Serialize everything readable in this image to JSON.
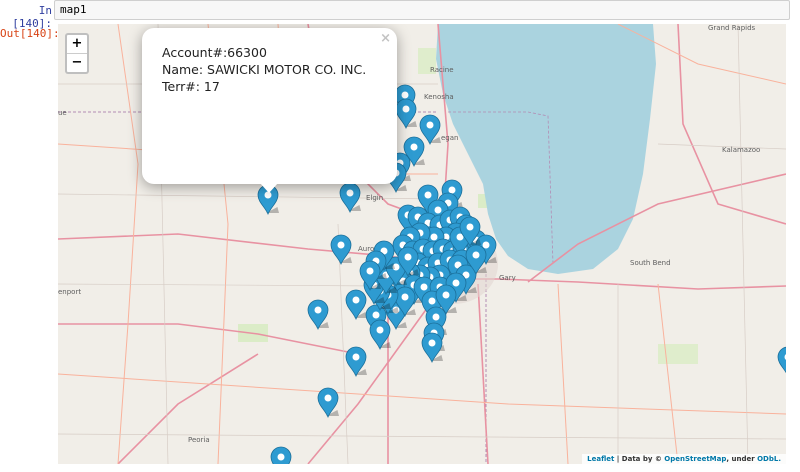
{
  "notebook": {
    "in_prompt": "In [140]:",
    "out_prompt": "Out[140]:",
    "input_code": "map1"
  },
  "map": {
    "zoom_in": "+",
    "zoom_out": "−",
    "popup": {
      "close": "×",
      "lines": [
        "Account#:66300",
        "Name: SAWICKI MOTOR CO. INC.",
        "Terr#: 17"
      ]
    },
    "places": {
      "racine": "Racine",
      "kenosha": "Kenosha",
      "waukegan": "egan",
      "elgin": "Elgin",
      "aurora": "Auro",
      "gary": "Gary",
      "south_bend": "South Bend",
      "kalamazoo": "Kalamazoo",
      "grand_rapids": "Grand Rapids",
      "davenport": "enport",
      "peoria": "Peoria",
      "left_edge": "ue"
    },
    "attribution": {
      "leaflet": "Leaflet",
      "data_by": " | Data by © ",
      "osm": "OpenStreetMap",
      "under": ", under ",
      "odbl": "ODbL."
    },
    "colors": {
      "lake": "#aad3df",
      "land": "#f1eee8",
      "marker": "#2e9bd1",
      "road": "#e892a2",
      "highway": "#f9b29c"
    }
  }
}
